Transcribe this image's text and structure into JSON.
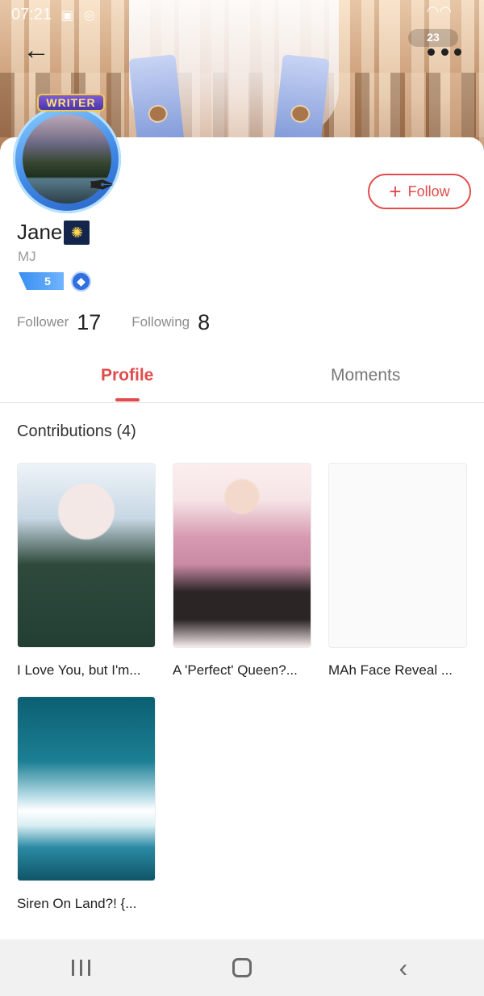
{
  "status_bar": {
    "time": "07:21",
    "icons": [
      "image-icon",
      "sync-icon",
      "mute-icon",
      "wifi-icon",
      "battery-icon"
    ]
  },
  "header": {
    "notification_count": "23"
  },
  "profile": {
    "badge": "WRITER",
    "name": "Jane",
    "handle": "MJ",
    "level": "5",
    "follow_label": "Follow"
  },
  "stats": {
    "follower_label": "Follower",
    "follower_count": "17",
    "following_label": "Following",
    "following_count": "8"
  },
  "tabs": [
    {
      "label": "Profile",
      "active": true
    },
    {
      "label": "Moments",
      "active": false
    }
  ],
  "contributions": {
    "title": "Contributions (4)",
    "items": [
      {
        "title": "I Love You, but I'm..."
      },
      {
        "title": "A 'Perfect' Queen?..."
      },
      {
        "title": "MAh Face Reveal ..."
      },
      {
        "title": "Siren On Land?! {..."
      }
    ]
  },
  "colors": {
    "accent": "#e24b4b",
    "level_badge": "#3a8ff0",
    "nav_bg": "#f1f1f1"
  }
}
